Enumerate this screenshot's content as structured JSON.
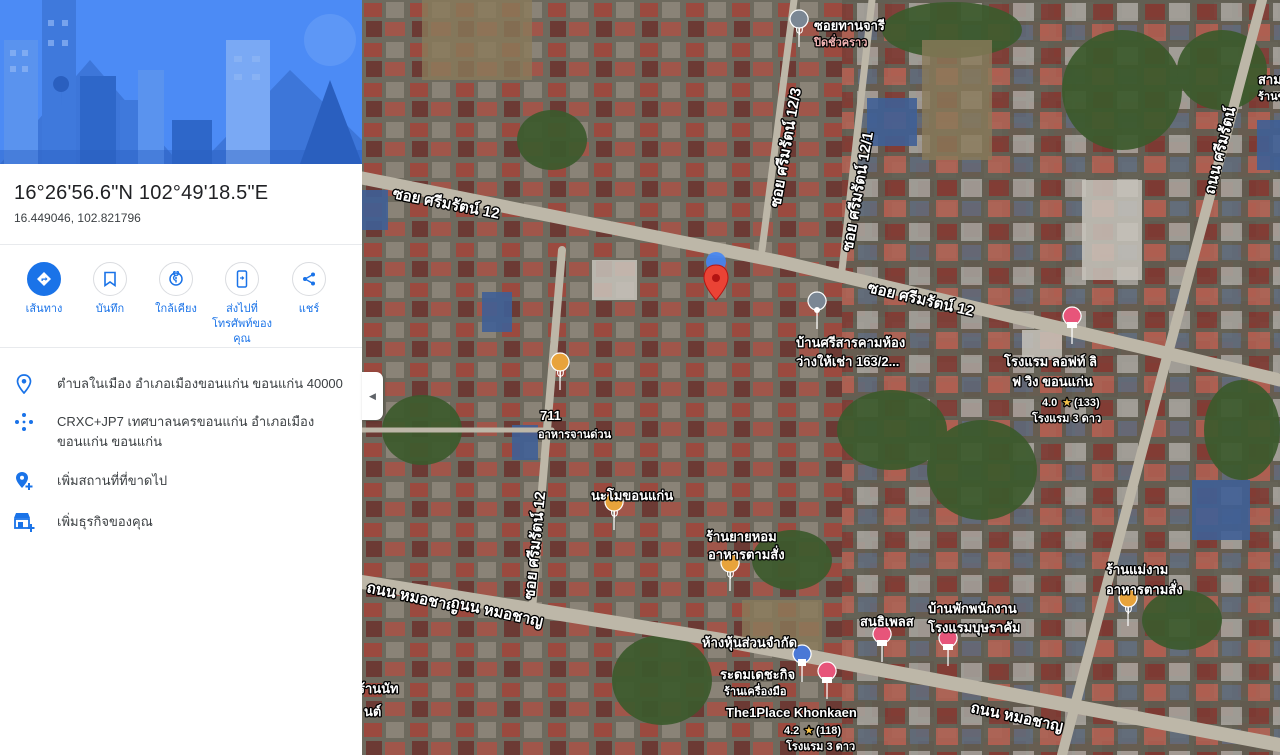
{
  "place": {
    "dms": "16°26'56.6\"N 102°49'18.5\"E",
    "decimal": "16.449046, 102.821796"
  },
  "actions": [
    {
      "label": "เส้นทาง",
      "icon": "directions-icon"
    },
    {
      "label": "บันทึก",
      "icon": "bookmark-icon"
    },
    {
      "label": "ใกล้เคียง",
      "icon": "nearby-icon"
    },
    {
      "label": "ส่งไปที่โทรศัพท์ของคุณ",
      "icon": "send-to-phone-icon"
    },
    {
      "label": "แชร์",
      "icon": "share-icon"
    }
  ],
  "info": {
    "address": "ตำบลในเมือง อำเภอเมืองขอนแก่น ขอนแก่น 40000",
    "pluscode": "CRXC+JP7 เทศบาลนครขอนแก่น อำเภอเมืองขอนแก่น ขอนแก่น",
    "add_place": "เพิ่มสถานที่ที่ขาดไป",
    "add_business": "เพิ่มธุรกิจของคุณ"
  },
  "map": {
    "roads": {
      "soi12_left": "ซอย ศรีมรัตน์ 12",
      "soi12_right": "ซอย ศรีมรัตน์ 12",
      "soi12_3": "ซอย ศรีมรัตน์ 12/3",
      "soi12_1": "ซอย ศรีมรัตน์ 12/1",
      "soi12_south": "ซอย ศรีมรัตน์ 12",
      "thanon_east": "ถนน ศรีมรัตน์",
      "mochayan_left": "ถนน หมอชาญ",
      "mochayan_mid": "ถนน หมอชาญ",
      "mochayan_right": "ถนน หมอชาญ"
    },
    "pois": {
      "soi_thanchari_1": "ซอยทานจารี",
      "soi_thanchari_2": "ปิดชั่วคราว",
      "ban_si_1": "บ้านศรีสารคามห้อง",
      "ban_si_2": "ว่างให้เช่า 163/2...",
      "hotel_loft_1": "โรงแรม ลอฟท์ ลิ",
      "hotel_loft_2": "ฟ วิง ขอนแก่น",
      "hotel_loft_rating": "4.0",
      "hotel_loft_reviews": "(133)",
      "hotel_loft_type": "โรงแรม 3 ดาว",
      "seven_1": "711",
      "seven_2": "อาหารจานด่วน",
      "namo": "นะโมขอนแก่น",
      "yaihom_1": "ร้านยายหอม",
      "yaihom_2": "อาหารตามสั่ง",
      "maegam_1": "ร้านแม่งาม",
      "maegam_2": "อาหารตามสั่ง",
      "sanpet": "สนธิเพลส",
      "banpak_1": "บ้านพักพนักงาน",
      "banpak_2": "โรงแรมบุษราคัม",
      "hanghun_1": "ห้างหุ้นส่วนจำกัด",
      "hanghun_2": "ระดมเดชะกิจ",
      "hanghun_3": "ร้านเครื่องมือ",
      "the1place": "The1Place Khonkaen",
      "the1place_rating": "4.2",
      "the1place_reviews": "(118)",
      "the1place_type": "โรงแรม 3 ดาว",
      "edge_right_1": "สาม",
      "edge_right_2": "ร้านขน",
      "edge_left_1": "ร้านนัท",
      "edge_left_2": "นต์"
    }
  }
}
